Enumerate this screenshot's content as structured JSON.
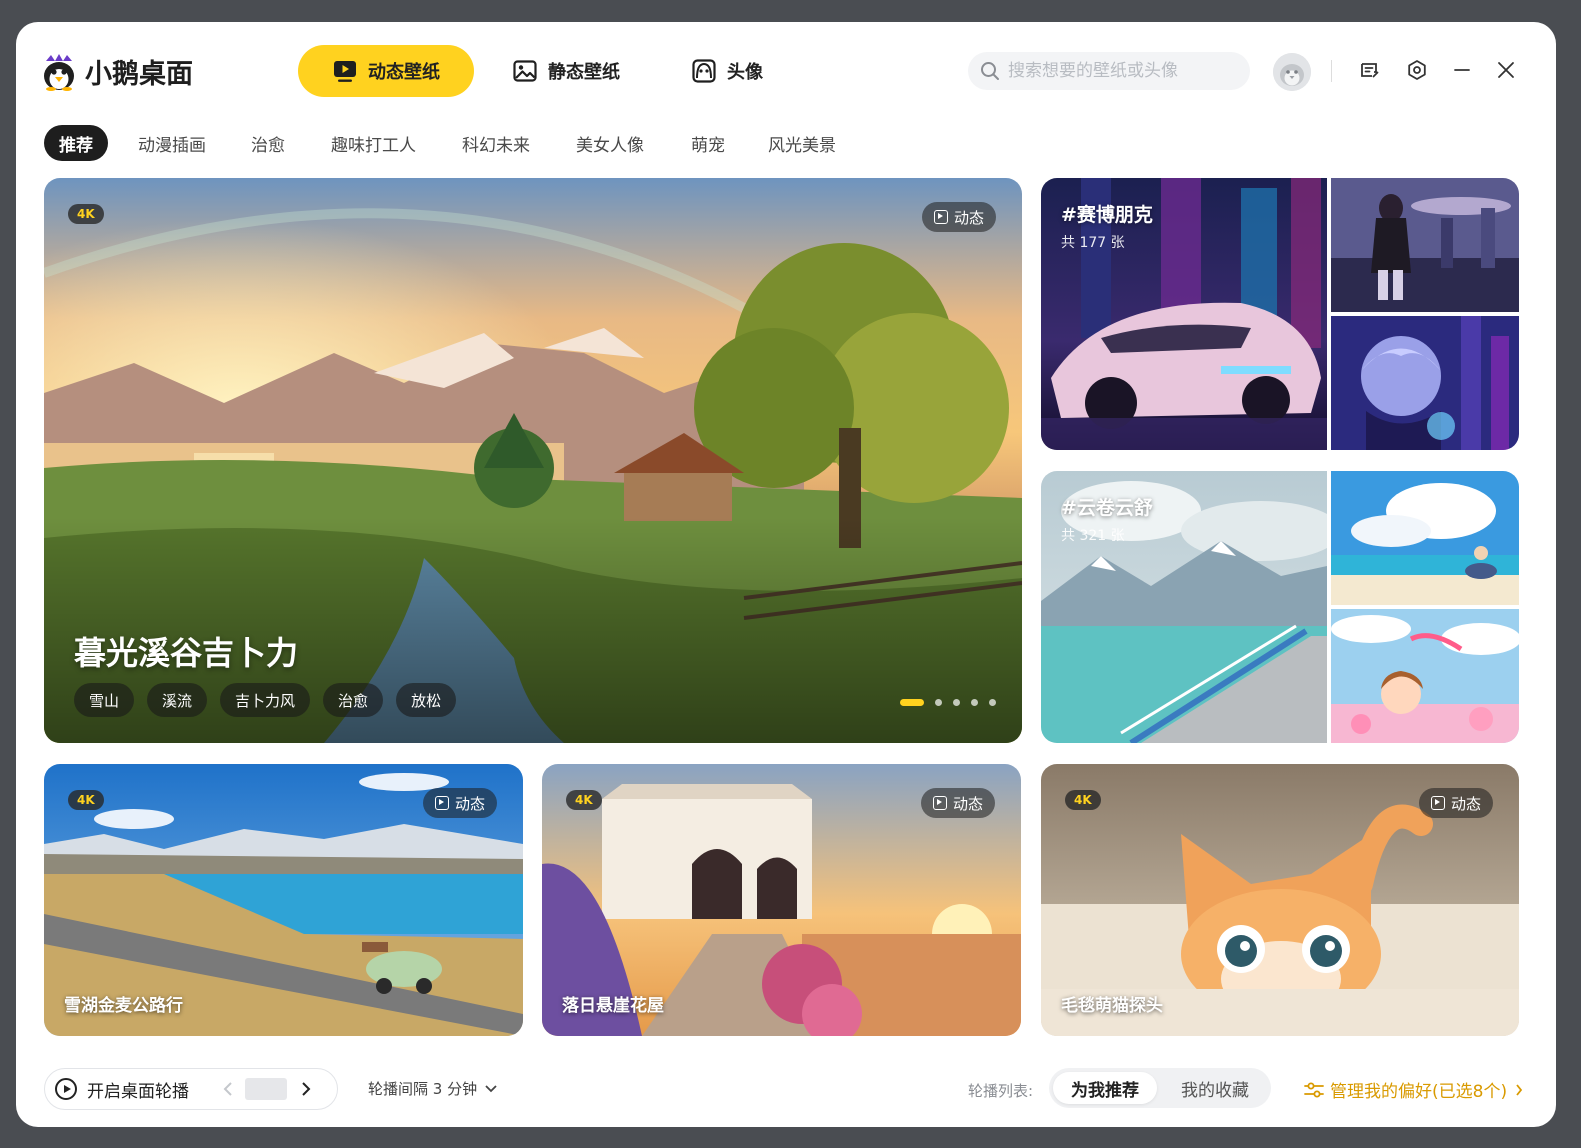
{
  "app": {
    "title": "小鹅桌面"
  },
  "nav": {
    "tabs": [
      {
        "label": "动态壁纸",
        "icon": "play-square-icon",
        "active": true
      },
      {
        "label": "静态壁纸",
        "icon": "image-icon",
        "active": false
      },
      {
        "label": "头像",
        "icon": "avatar-face-icon",
        "active": false
      }
    ]
  },
  "search": {
    "placeholder": "搜索想要的壁纸或头像",
    "value": ""
  },
  "window_controls": [
    "feedback-icon",
    "settings-icon",
    "minimize-icon",
    "close-icon"
  ],
  "categories": [
    "推荐",
    "动漫插画",
    "治愈",
    "趣味打工人",
    "科幻未来",
    "美女人像",
    "萌宠",
    "风光美景"
  ],
  "active_category": "推荐",
  "hero": {
    "badge": "4K",
    "type_label": "动态",
    "title": "暮光溪谷吉卜力",
    "tags": [
      "雪山",
      "溪流",
      "吉卜力风",
      "治愈",
      "放松"
    ],
    "carousel_index": 1,
    "carousel_total": 5
  },
  "collections": [
    {
      "title": "#赛博朋克",
      "count": "共 177 张"
    },
    {
      "title": "#云卷云舒",
      "count": "共 321 张"
    }
  ],
  "wallpapers": [
    {
      "title": "雪湖金麦公路行",
      "badge": "4K",
      "type_label": "动态"
    },
    {
      "title": "落日悬崖花屋",
      "badge": "4K",
      "type_label": "动态"
    },
    {
      "title": "毛毯萌猫探头",
      "badge": "4K",
      "type_label": "动态"
    }
  ],
  "bottom_bar": {
    "carousel_label": "开启桌面轮播",
    "interval_label": "轮播间隔 3 分钟",
    "list_label": "轮播列表:",
    "list_options": [
      "为我推荐",
      "我的收藏"
    ],
    "list_selected": "为我推荐",
    "manage_label": "管理我的偏好(已选8个)"
  },
  "colors": {
    "accent": "#ffd21f",
    "dark": "#1e1e1e",
    "manage": "#d99a00"
  }
}
